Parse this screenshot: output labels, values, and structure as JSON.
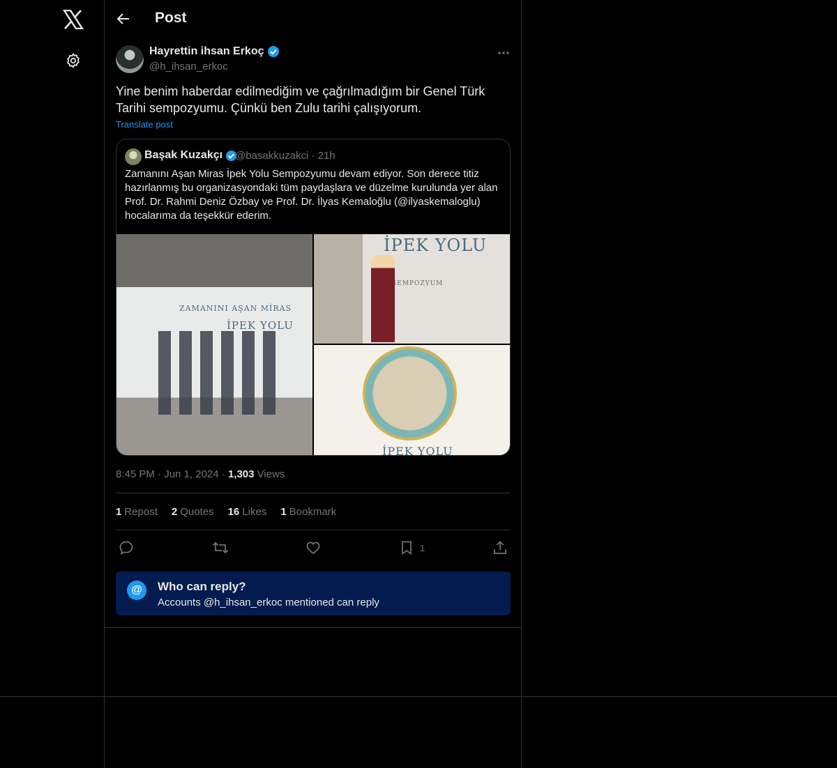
{
  "nav": {
    "logo_icon": "x-logo-icon",
    "settings_icon": "gear-icon"
  },
  "header": {
    "title": "Post"
  },
  "post": {
    "author_name": "Hayrettin ihsan Erkoç",
    "author_handle": "@h_ihsan_erkoc",
    "text": "Yine benim haberdar edilmediğim ve çağrılmadığım bir Genel Türk Tarihi sempozyumu. Çünkü ben Zulu tarihi çalışıyorum.",
    "translate_label": "Translate post",
    "time": "8:45 PM · Jun 1, 2024 ·",
    "views_count": "1,303",
    "views_label": "Views"
  },
  "quote": {
    "author_name": "Başak Kuzakçı",
    "author_handle": "@basakkuzakci",
    "age": "21h",
    "text": "Zamanını Aşan Miras İpek Yolu Sempozyumu devam ediyor. Son derece titiz hazırlanmış bu organizasyondaki tüm paydaşlara ve düzelme kurulunda yer alan Prof. Dr. Rahmi Deniz Özbay ve Prof. Dr. İlyas Kemaloğlu (@ilyaskemaloglu) hocalarıma da teşekkür ederim.",
    "photo_captions": [
      "ZAMANINI AŞAN MİRAS",
      "İPEK YOLU",
      "İPEK YOLU",
      "SEMPOZYUM",
      "İPEK YOLU"
    ]
  },
  "stats": [
    {
      "count": "1",
      "label": "Repost"
    },
    {
      "count": "2",
      "label": "Quotes"
    },
    {
      "count": "16",
      "label": "Likes"
    },
    {
      "count": "1",
      "label": "Bookmark"
    }
  ],
  "actions": {
    "bookmark_count": "1"
  },
  "reply_restriction": {
    "title": "Who can reply?",
    "subtitle": "Accounts @h_ihsan_erkoc mentioned can reply"
  },
  "colors": {
    "accent": "#1d9bf0",
    "background": "#000000",
    "border": "#2f3336",
    "muted": "#71767b",
    "reply_box": "#031b4e"
  }
}
